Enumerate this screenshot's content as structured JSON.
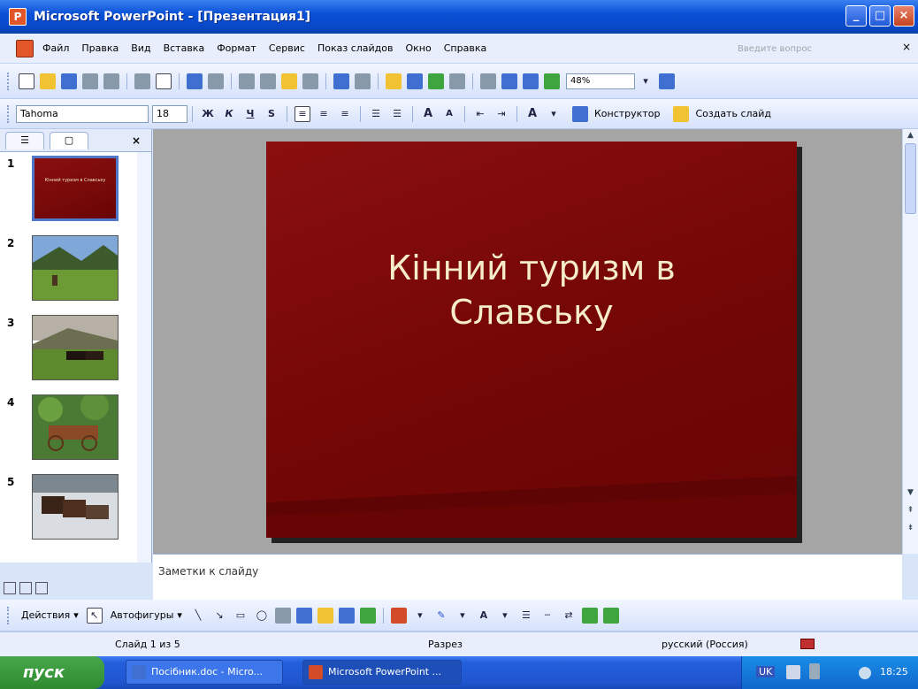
{
  "window": {
    "title": "Microsoft PowerPoint - [Презентация1]",
    "controls": {
      "minimize": "_",
      "maximize": "□",
      "close": "×"
    }
  },
  "menu": {
    "items": [
      "Файл",
      "Правка",
      "Вид",
      "Вставка",
      "Формат",
      "Сервис",
      "Показ слайдов",
      "Окно",
      "Справка"
    ],
    "help_placeholder": "Введите вопрос",
    "close_glyph": "×"
  },
  "toolbar_standard": {
    "zoom": "48%"
  },
  "toolbar_format": {
    "font": "Tahoma",
    "font_size": "18",
    "bold": "Ж",
    "italic": "К",
    "underline": "Ч",
    "shadow": "S",
    "grow_font": "A",
    "shrink_font": "A",
    "font_color": "A",
    "designer": "Конструктор",
    "new_slide": "Создать слайд"
  },
  "slides_pane": {
    "close_glyph": "×",
    "slides": [
      {
        "number": "1",
        "kind": "title",
        "thumb_text": "Кінний туризм в Славську"
      },
      {
        "number": "2",
        "kind": "photo-mountains"
      },
      {
        "number": "3",
        "kind": "photo-horses"
      },
      {
        "number": "4",
        "kind": "photo-cart"
      },
      {
        "number": "5",
        "kind": "photo-sleigh"
      }
    ],
    "selected": 1
  },
  "slide": {
    "title_line1": "Кінний туризм в",
    "title_line2": "Славську",
    "background": "#730606",
    "title_color": "#f5ecc8"
  },
  "notes": {
    "placeholder": "Заметки к слайду"
  },
  "drawing_toolbar": {
    "actions": "Действия",
    "autoshapes": "Автофигуры",
    "font_color": "A"
  },
  "status": {
    "slide_info": "Слайд 1 из 5",
    "design": "Разрез",
    "language": "русский (Россия)"
  },
  "taskbar": {
    "start": "пуск",
    "buttons": [
      {
        "label": "Посібник.doc - Micro...",
        "active": false
      },
      {
        "label": "Microsoft PowerPoint ...",
        "active": true
      }
    ],
    "tray_lang": "UK",
    "clock": "18:25"
  }
}
